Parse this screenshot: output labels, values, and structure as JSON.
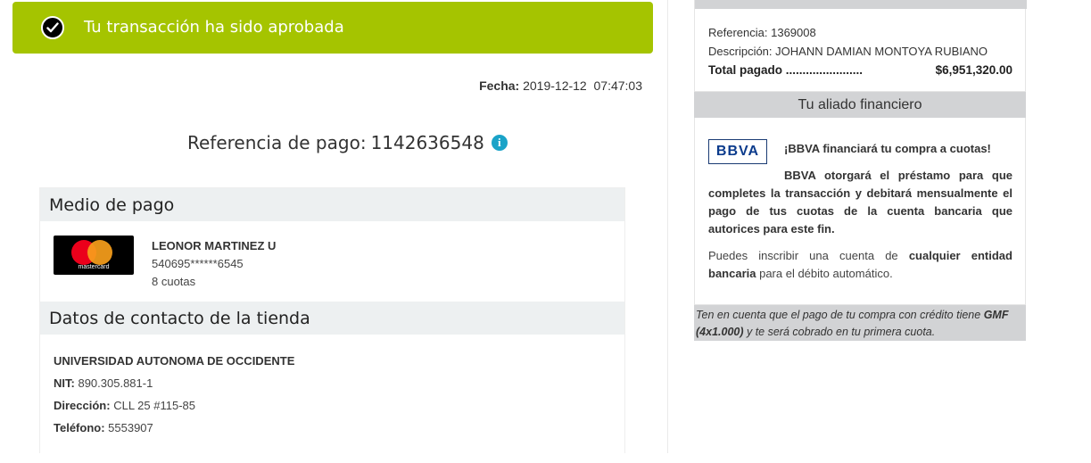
{
  "colors": {
    "banner": "#a5c400",
    "info_icon": "#1aa3c8",
    "bbva_blue": "#0b3b8c"
  },
  "banner": {
    "icon": "checkmark-icon",
    "text": "Tu transacción ha sido aprobada"
  },
  "fecha": {
    "label": "Fecha:",
    "value": "2019-12-12  07:47:03"
  },
  "payment_reference": {
    "label": "Referencia de pago:",
    "value": "1142636548",
    "icon": "info-icon"
  },
  "payment_method": {
    "title": "Medio de pago",
    "card_brand": "mastercard",
    "holder": "LEONOR MARTINEZ U",
    "card_number": "540695******6545",
    "installments": "8 cuotas"
  },
  "store_contact": {
    "title": "Datos de contacto de la tienda",
    "name": "UNIVERSIDAD AUTONOMA DE OCCIDENTE",
    "nit_label": "NIT:",
    "nit": "890.305.881-1",
    "address_label": "Dirección:",
    "address": "CLL 25 #115-85",
    "phone_label": "Teléfono:",
    "phone": "5553907"
  },
  "summary": {
    "reference_label": "Referencia:",
    "reference": "1369008",
    "description_label": "Descripción:",
    "description": "JOHANN DAMIAN MONTOYA RUBIANO",
    "total_label": "Total pagado .......................",
    "total": "$6,951,320.00"
  },
  "financial_partner": {
    "title": "Tu aliado financiero",
    "logo_text": "BBVA",
    "headline": "¡BBVA financiará tu compra a cuotas!",
    "paragraph": "BBVA otorgará el préstamo para que completes la transacción y debitará mensualmente el pago de tus cuotas de la cuenta bancaria que autorices para este fin.",
    "p2_start": "Puedes inscribir una cuenta de ",
    "p2_bold": "cualquier entidad bancaria",
    "p2_end": " para el débito automático."
  },
  "gmf_note": {
    "start": "Ten en cuenta que el pago de tu compra con crédito tiene ",
    "bold": "GMF (4x1.000)",
    "end": " y te será cobrado en tu primera cuota."
  }
}
